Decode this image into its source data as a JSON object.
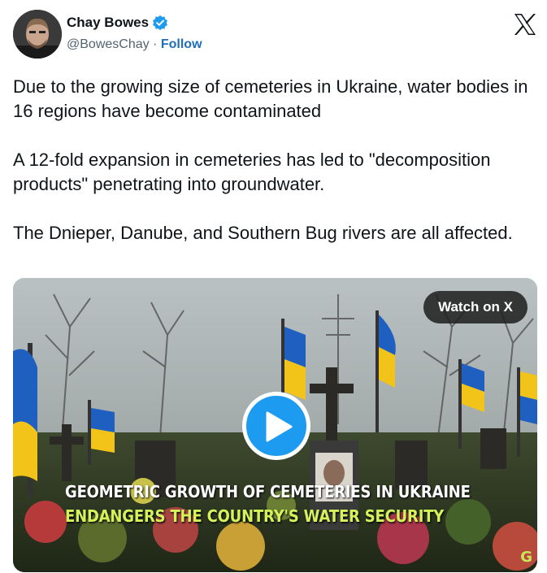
{
  "author": {
    "display_name": "Chay Bowes",
    "handle": "@BowesChay",
    "separator": "·",
    "follow_label": "Follow",
    "verified_icon": "verified-badge-icon",
    "verified_color": "#1d9bf0"
  },
  "platform": {
    "logo_icon": "x-logo-icon"
  },
  "tweet": {
    "text": "Due to the growing size of cemeteries in Ukraine, water bodies in 16 regions have become contaminated\n\nA 12-fold expansion in cemeteries has led to \"decomposition products\" penetrating into groundwater.\n\nThe Dnieper, Danube, and Southern Bug rivers are all affected."
  },
  "media": {
    "watch_label": "Watch on X",
    "play_icon": "play-icon",
    "play_color": "#1d9bf0",
    "caption_line1": "GEOMETRIC GROWTH OF CEMETERIES IN UKRAINE",
    "caption_line2": "ENDANGERS THE COUNTRY'S WATER SECURITY",
    "caption_line2_color": "#d6f25a",
    "corner_logo": "G",
    "scene_description_colors": {
      "flag_blue": "#1f5fbf",
      "flag_yellow": "#f2c419"
    }
  }
}
